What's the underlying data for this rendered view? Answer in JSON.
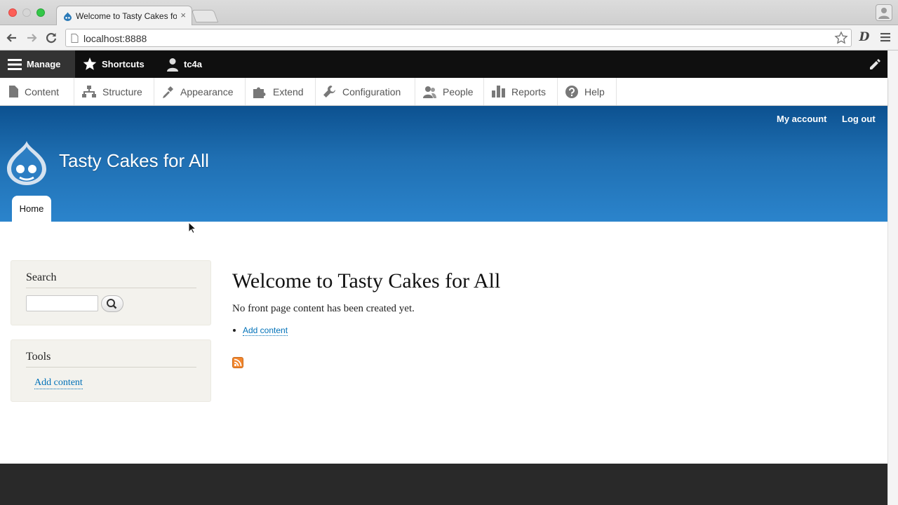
{
  "browser": {
    "tab_title": "Welcome to Tasty Cakes fo",
    "tab_close": "×",
    "url": "localhost:8888"
  },
  "toolbar": {
    "manage": "Manage",
    "shortcuts": "Shortcuts",
    "user": "tc4a"
  },
  "admin_menu": {
    "items": [
      {
        "label": "Content",
        "icon": "file-icon"
      },
      {
        "label": "Structure",
        "icon": "sitemap-icon"
      },
      {
        "label": "Appearance",
        "icon": "paintbrush-icon"
      },
      {
        "label": "Extend",
        "icon": "puzzle-icon"
      },
      {
        "label": "Configuration",
        "icon": "wrench-icon"
      },
      {
        "label": "People",
        "icon": "people-icon"
      },
      {
        "label": "Reports",
        "icon": "bar-chart-icon"
      },
      {
        "label": "Help",
        "icon": "help-icon"
      }
    ]
  },
  "header": {
    "my_account": "My account",
    "log_out": "Log out",
    "site_name": "Tasty Cakes for All",
    "primary_tab": "Home"
  },
  "sidebar": {
    "search_title": "Search",
    "tools_title": "Tools",
    "tools_link": "Add content"
  },
  "main": {
    "title": "Welcome to Tasty Cakes for All",
    "empty_text": "No front page content has been created yet.",
    "add_link": "Add content"
  },
  "colors": {
    "header_top": "#0c5190",
    "header_bottom": "#2b84cc",
    "toolbar": "#0f0f0f",
    "link": "#0071b8",
    "footer": "#292929"
  }
}
